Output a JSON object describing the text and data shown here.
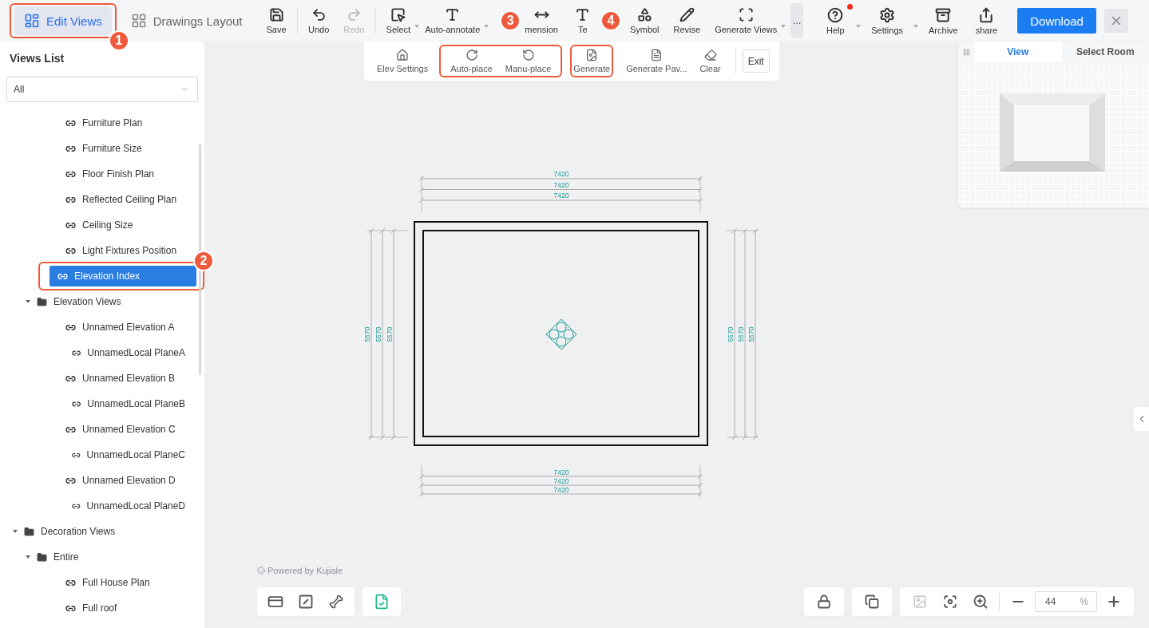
{
  "mode_tabs": [
    {
      "label": "Edit Views",
      "selected": true
    },
    {
      "label": "Drawings Layout",
      "selected": false
    }
  ],
  "toolbar": {
    "groups": [
      [
        {
          "label": "Save",
          "disabled": false,
          "dropdown": false
        }
      ],
      [
        {
          "label": "Undo",
          "disabled": false,
          "dropdown": false
        },
        {
          "label": "Redo",
          "disabled": true,
          "dropdown": false
        }
      ],
      [
        {
          "label": "Select",
          "disabled": false,
          "dropdown": true
        },
        {
          "label": "Auto-annotate",
          "disabled": false,
          "dropdown": true
        },
        {
          "label": "mension",
          "disabled": false,
          "dropdown": false
        },
        {
          "label": "Te",
          "disabled": false,
          "dropdown": false
        },
        {
          "label": "Symbol",
          "disabled": false,
          "dropdown": false
        },
        {
          "label": "Revise",
          "disabled": false,
          "dropdown": false
        },
        {
          "label": "Generate Views",
          "disabled": false,
          "dropdown": true
        }
      ]
    ],
    "more": "...",
    "right_tools": [
      {
        "label": "Help",
        "dropdown": true,
        "notification": true
      },
      {
        "label": "Settings",
        "dropdown": true,
        "notification": false
      },
      {
        "label": "Archive",
        "dropdown": false,
        "notification": false
      },
      {
        "label": "share",
        "dropdown": false,
        "notification": false
      }
    ],
    "download": "Download"
  },
  "sidebar": {
    "title": "Views List",
    "filter": {
      "value": "All"
    },
    "tree": [
      {
        "kind": "continued",
        "children": [
          {
            "kind": "continued",
            "children": [
              {
                "kind": "view",
                "label": "Furniture Plan",
                "selected": false
              },
              {
                "kind": "view",
                "label": "Furniture Size",
                "selected": false
              },
              {
                "kind": "view",
                "label": "Floor Finish Plan",
                "selected": false
              },
              {
                "kind": "view",
                "label": "Reflected Ceiling Plan",
                "selected": false
              },
              {
                "kind": "view",
                "label": "Ceiling Size",
                "selected": false
              },
              {
                "kind": "view",
                "label": "Light Fixtures Position",
                "selected": false
              },
              {
                "kind": "view",
                "label": "Elevation Index",
                "selected": true
              }
            ]
          },
          {
            "kind": "folder",
            "label": "Elevation Views",
            "expanded": true,
            "children": [
              {
                "kind": "view",
                "label": "Unnamed Elevation A",
                "selected": false,
                "children": [
                  {
                    "kind": "view",
                    "label": "UnnamedLocal PlaneA",
                    "selected": false
                  }
                ]
              },
              {
                "kind": "view",
                "label": "Unnamed Elevation B",
                "selected": false,
                "children": [
                  {
                    "kind": "view",
                    "label": "UnnamedLocal PlaneB",
                    "selected": false
                  }
                ]
              },
              {
                "kind": "view",
                "label": "Unnamed Elevation C",
                "selected": false,
                "children": [
                  {
                    "kind": "view",
                    "label": "UnnamedLocal PlaneC",
                    "selected": false
                  }
                ]
              },
              {
                "kind": "view",
                "label": "Unnamed Elevation D",
                "selected": false,
                "children": [
                  {
                    "kind": "view",
                    "label": "UnnamedLocal PlaneD",
                    "selected": false
                  }
                ]
              }
            ]
          }
        ]
      },
      {
        "kind": "folder",
        "label": "Decoration Views",
        "expanded": true,
        "children": [
          {
            "kind": "folder",
            "label": "Entire",
            "expanded": true,
            "children": [
              {
                "kind": "view",
                "label": "Full House Plan",
                "selected": false
              },
              {
                "kind": "view",
                "label": "Full roof",
                "selected": false
              }
            ]
          }
        ]
      }
    ]
  },
  "elevation_toolbar": {
    "tools": [
      {
        "label": "Elev Settings"
      },
      {
        "label": "Auto-place"
      },
      {
        "label": "Manu-place"
      },
      {
        "label": "Generate"
      },
      {
        "label": "Generate Pav..."
      },
      {
        "label": "Clear"
      }
    ],
    "exit": "Exit"
  },
  "drawing": {
    "top_dimensions": [
      "7420",
      "7420",
      "7420"
    ],
    "bottom_dimensions": [
      "7420",
      "7420",
      "7420"
    ],
    "left_dimensions": [
      "5570",
      "5570",
      "5570"
    ],
    "right_dimensions": [
      "5570",
      "5570",
      "5570"
    ]
  },
  "minimap": {
    "tabs": [
      {
        "label": "View",
        "selected": true
      },
      {
        "label": "Select Room",
        "selected": false
      }
    ]
  },
  "powered_by": "Powered by Kujiale",
  "zoom": {
    "value": "44",
    "unit": "%"
  },
  "annotations": [
    {
      "number": "1"
    },
    {
      "number": "2"
    },
    {
      "number": "3"
    },
    {
      "number": "4"
    }
  ]
}
